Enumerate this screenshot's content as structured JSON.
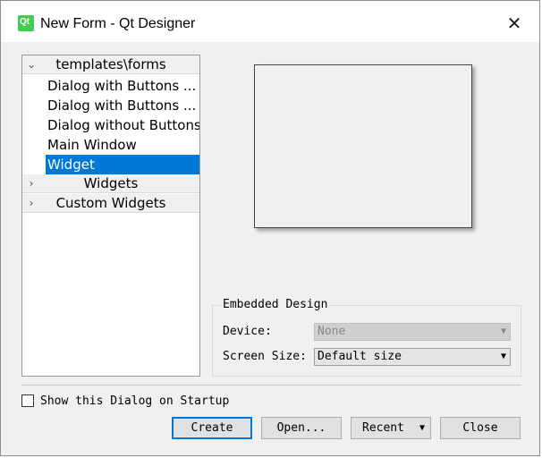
{
  "window": {
    "title": "New Form - Qt Designer",
    "close_glyph": "✕"
  },
  "tree": {
    "categories": [
      {
        "label": "templates\\forms",
        "arrow": "⌄"
      },
      {
        "label": "Widgets",
        "arrow": "›"
      },
      {
        "label": "Custom Widgets",
        "arrow": "›"
      }
    ],
    "items": [
      "Dialog with Buttons ...",
      "Dialog with Buttons ...",
      "Dialog without Buttons",
      "Main Window",
      "Widget"
    ],
    "selected": "Widget"
  },
  "embedded": {
    "title": "Embedded Design",
    "device_label": "Device:",
    "device_value": "None",
    "screen_label": "Screen Size:",
    "screen_value": "Default size"
  },
  "startup": {
    "label": "Show this Dialog on Startup",
    "checked": false
  },
  "buttons": {
    "create": "Create",
    "open": "Open...",
    "recent": "Recent",
    "close": "Close"
  },
  "colors": {
    "selection": "#0078d7",
    "qt_green": "#41cd52"
  }
}
